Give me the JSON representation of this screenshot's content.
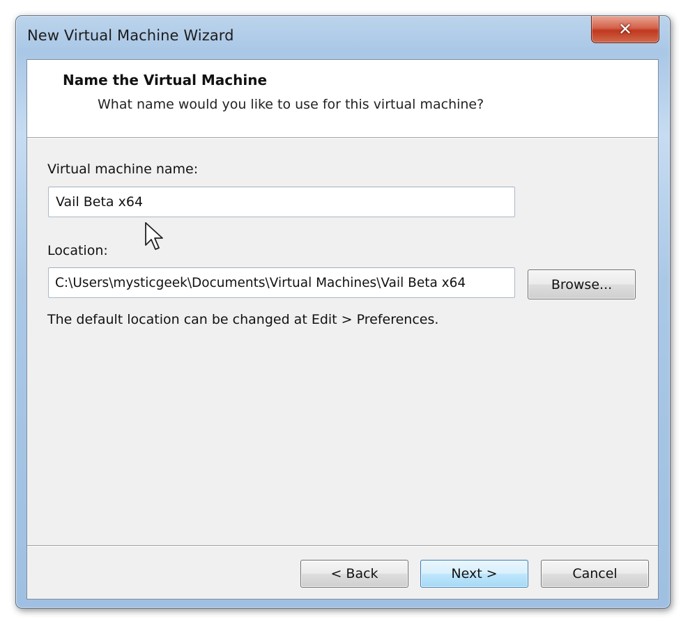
{
  "window": {
    "title": "New Virtual Machine Wizard",
    "close_glyph": "✕"
  },
  "header": {
    "title": "Name the Virtual Machine",
    "subtitle": "What name would you like to use for this virtual machine?"
  },
  "form": {
    "name_label": "Virtual machine name:",
    "name_value": "Vail Beta x64",
    "location_label": "Location:",
    "location_value": "C:\\Users\\mysticgeek\\Documents\\Virtual Machines\\Vail Beta x64",
    "browse_label": "Browse...",
    "hint": "The default location can be changed at Edit > Preferences."
  },
  "buttons": {
    "back": "< Back",
    "next": "Next >",
    "cancel": "Cancel"
  },
  "icons": {
    "close": "close-icon",
    "cursor": "mouse-pointer-icon"
  }
}
